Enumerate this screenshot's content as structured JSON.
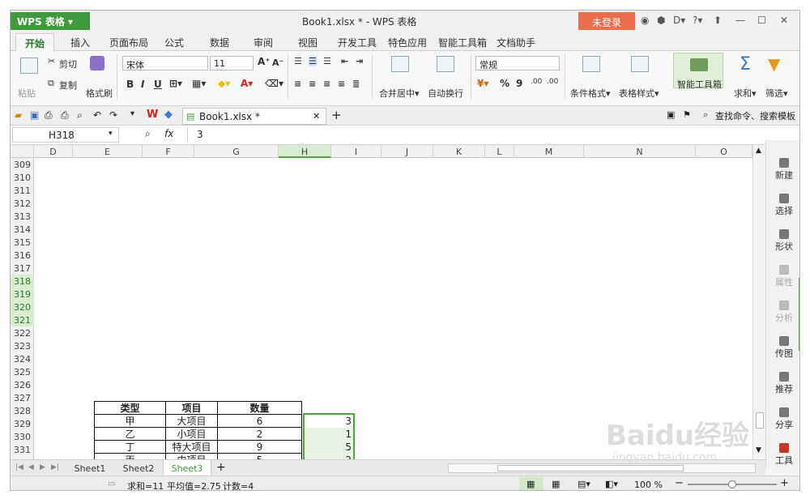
{
  "window": {
    "logo": "WPS 表格",
    "title": "Book1.xlsx * - WPS 表格",
    "login": "未登录"
  },
  "tabs": [
    "开始",
    "插入",
    "页面布局",
    "公式",
    "数据",
    "审阅",
    "视图",
    "开发工具",
    "特色应用",
    "智能工具箱",
    "文档助手"
  ],
  "ribbon": {
    "paste": "粘贴",
    "cut": "剪切",
    "copy": "复制",
    "format_painter": "格式刷",
    "font_name": "宋体",
    "font_size": "11",
    "bold": "B",
    "italic": "I",
    "underline": "U",
    "merge": "合并居中",
    "wrap": "自动换行",
    "number_format": "常规",
    "percent": "%",
    "comma": "9",
    "cond_format": "条件格式",
    "table_style": "表格样式",
    "smart_toolbox": "智能工具箱",
    "sum": "求和",
    "filter": "筛选"
  },
  "qat": {
    "doc_tab": "Book1.xlsx *",
    "search": "查找命令、搜索模板"
  },
  "formula_bar": {
    "name_box": "H318",
    "fx": "fx",
    "value": "3"
  },
  "columns": [
    "D",
    "E",
    "F",
    "G",
    "H",
    "I",
    "J",
    "K",
    "L",
    "M",
    "N",
    "O"
  ],
  "rows": [
    "309",
    "310",
    "311",
    "312",
    "313",
    "314",
    "315",
    "316",
    "317",
    "318",
    "319",
    "320",
    "321",
    "322",
    "323",
    "324",
    "325",
    "326",
    "327",
    "328",
    "329",
    "330",
    "331",
    "332"
  ],
  "table": {
    "headers": [
      "类型",
      "项目",
      "数量"
    ],
    "rows": [
      [
        "甲",
        "大项目",
        "6"
      ],
      [
        "乙",
        "小项目",
        "2"
      ],
      [
        "丁",
        "特大项目",
        "9"
      ],
      [
        "丙",
        "中项目",
        "5"
      ]
    ]
  },
  "selection_values": [
    "3",
    "1",
    "5",
    "2"
  ],
  "side_panel": [
    "新建",
    "选择",
    "形状",
    "属性",
    "分析",
    "传图",
    "推荐",
    "分享",
    "工具"
  ],
  "sheets": [
    "Sheet1",
    "Sheet2",
    "Sheet3"
  ],
  "active_sheet": "Sheet3",
  "status": {
    "sum": "求和=11",
    "avg": "平均值=2.75",
    "count": "计数=4",
    "zoom": "100 %"
  },
  "watermark": {
    "brand": "Baidu经验",
    "url": "jingyan.baidu.com"
  },
  "colors": {
    "accent": "#3f9a3b",
    "login": "#ea6d4e",
    "selection": "#52a441",
    "arrow": "#d9262a"
  }
}
